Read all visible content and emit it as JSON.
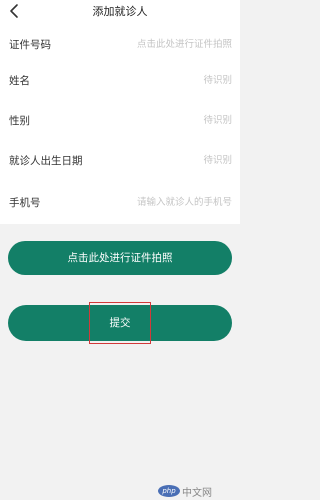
{
  "header": {
    "title": "添加就诊人",
    "back_icon": "chevron-left-icon"
  },
  "form": {
    "fields": [
      {
        "label": "证件号码",
        "value": "",
        "placeholder": "点击此处进行证件拍照"
      },
      {
        "label": "姓名",
        "value": "",
        "placeholder": "待识别"
      },
      {
        "label": "性别",
        "value": "",
        "placeholder": "待识别"
      },
      {
        "label": "就诊人出生日期",
        "value": "",
        "placeholder": "待识别"
      },
      {
        "label": "手机号",
        "value": "",
        "placeholder": "请输入就诊人的手机号"
      }
    ]
  },
  "actions": {
    "photo_label": "点击此处进行证件拍照",
    "submit_label": "提交"
  },
  "watermark": {
    "logo": "php",
    "text": "中文网"
  },
  "colors": {
    "primary": "#137f67",
    "highlight": "#d23a3a",
    "background": "#f2f2f2",
    "placeholder": "#c4c4c4"
  }
}
